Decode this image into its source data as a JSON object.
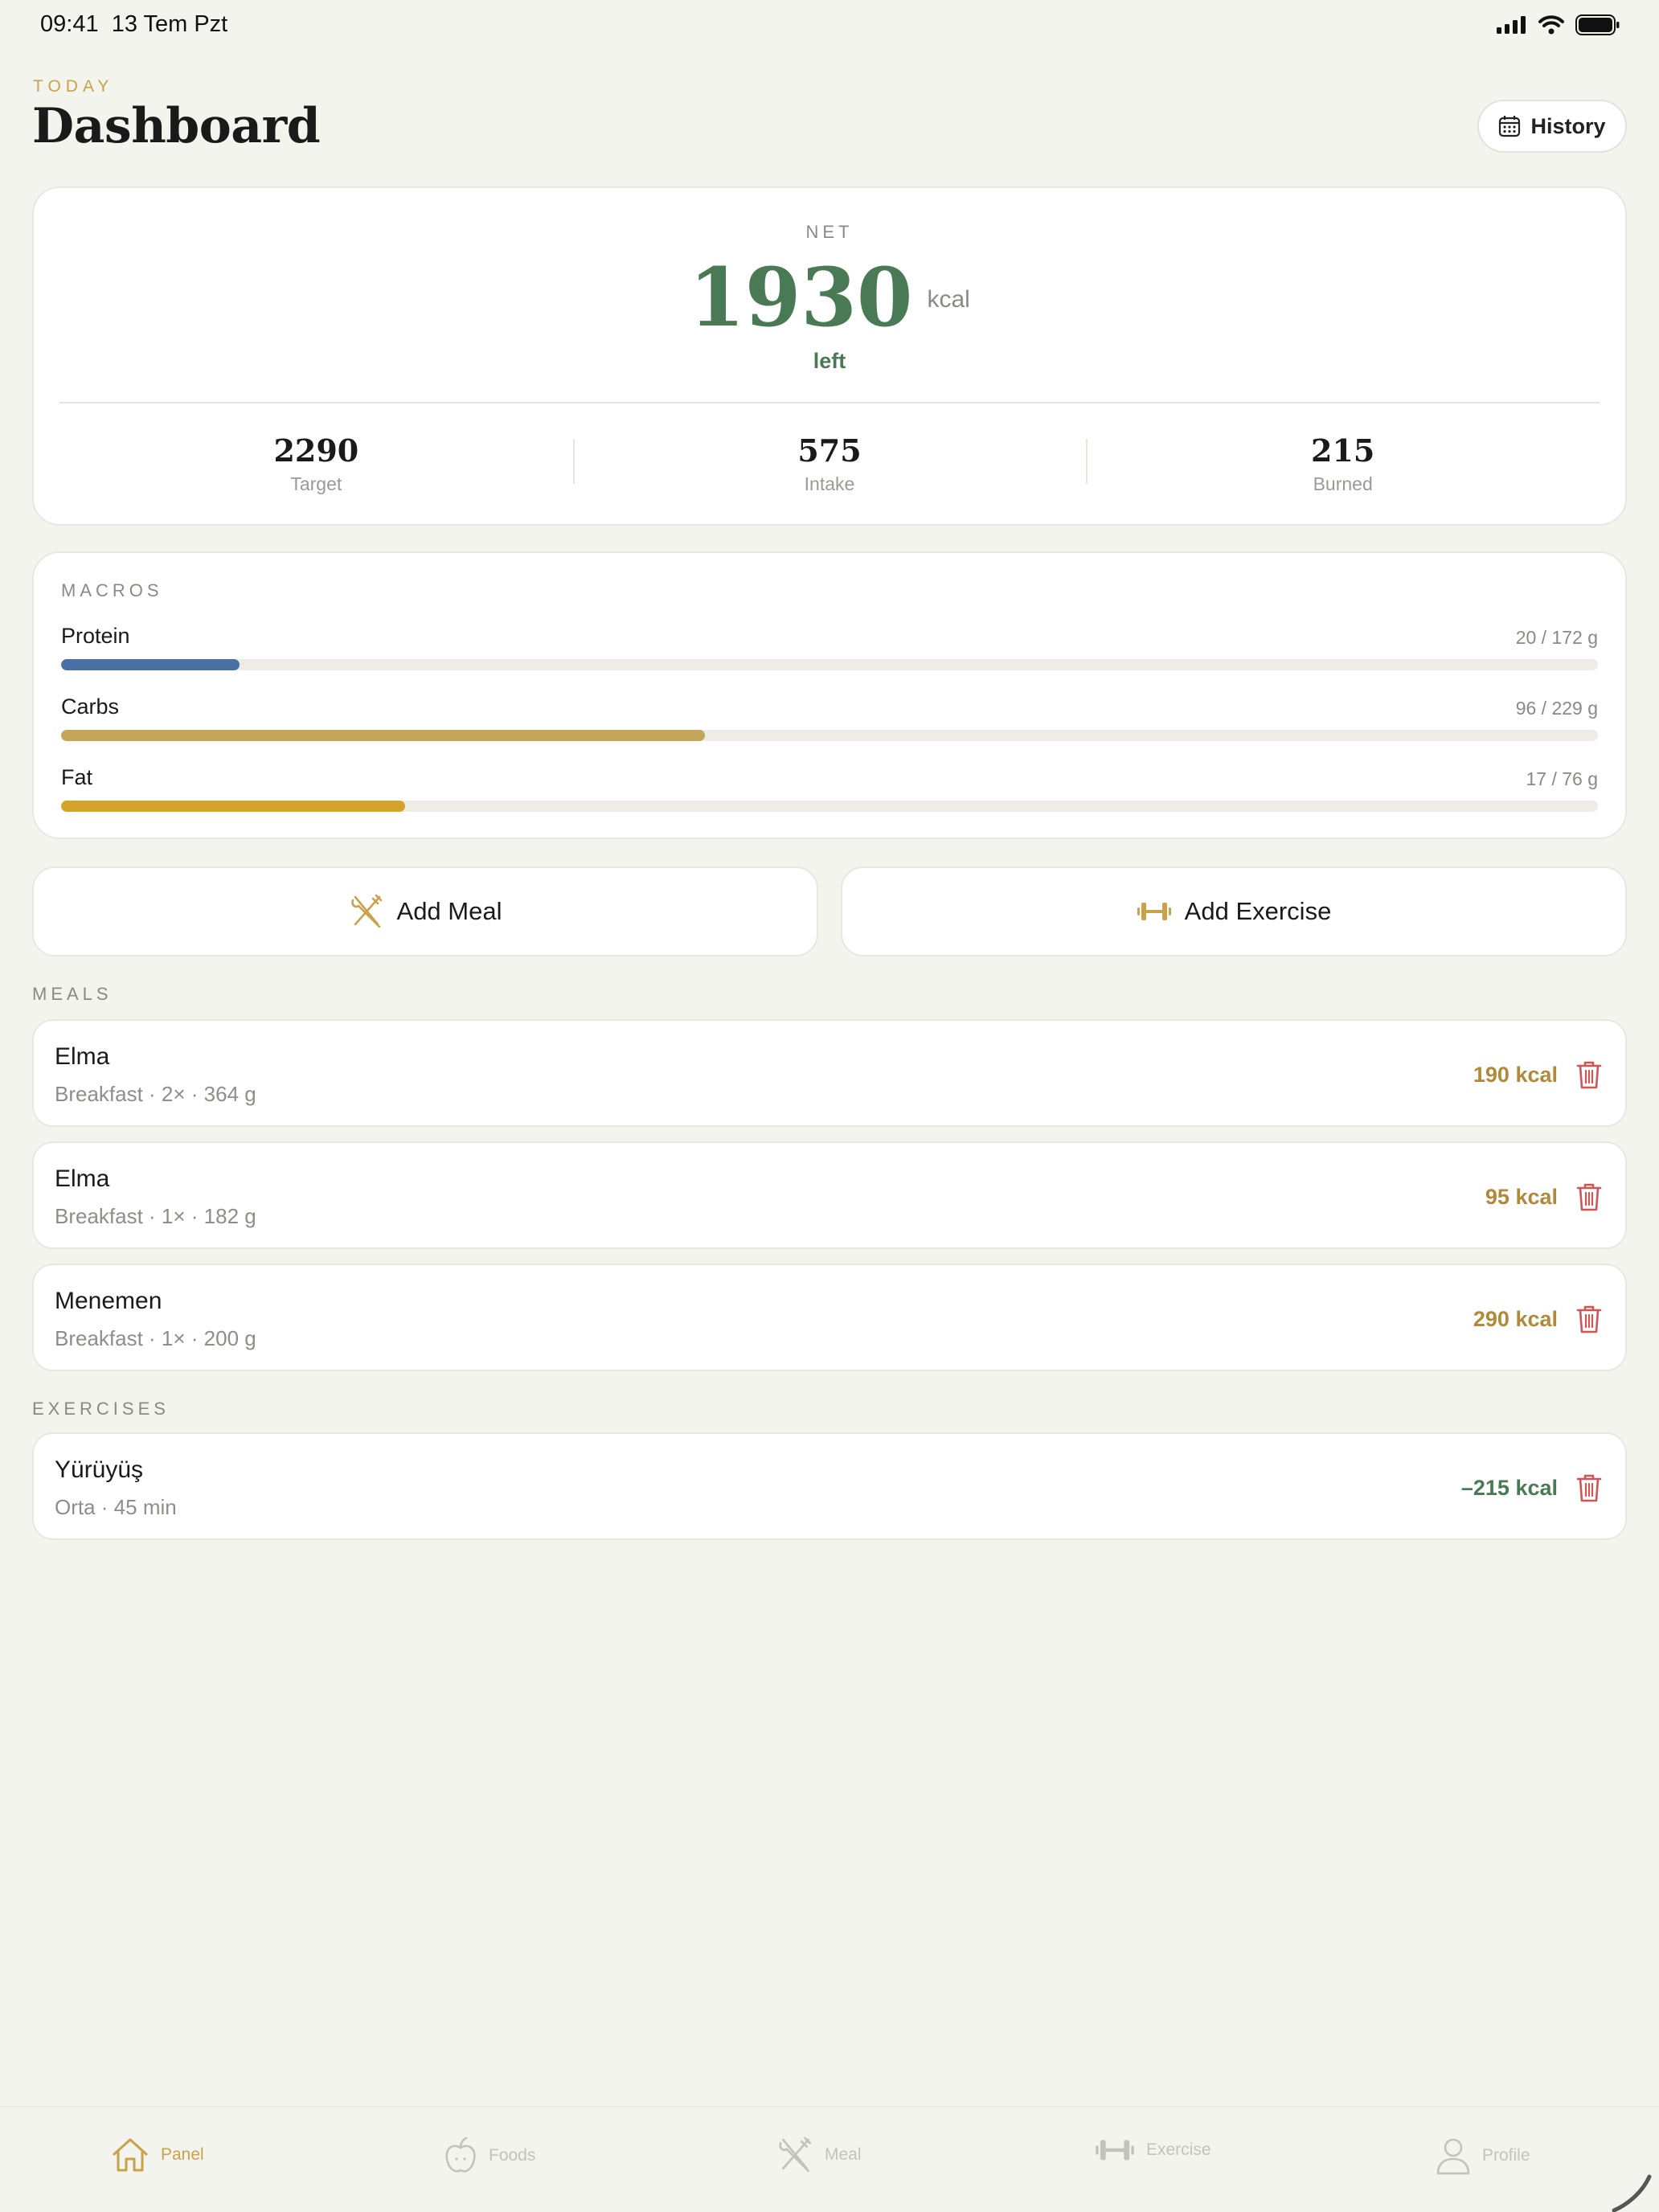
{
  "status_bar": {
    "time": "09:41",
    "date": "13 Tem Pzt"
  },
  "header": {
    "eyebrow": "TODAY",
    "title": "Dashboard",
    "history_label": "History"
  },
  "net": {
    "label": "NET",
    "value": "1930",
    "unit": "kcal",
    "sublabel": "left"
  },
  "stats": [
    {
      "value": "2290",
      "label": "Target"
    },
    {
      "value": "575",
      "label": "Intake"
    },
    {
      "value": "215",
      "label": "Burned"
    }
  ],
  "macros": {
    "label": "MACROS",
    "items": [
      {
        "name": "Protein",
        "value_text": "20 / 172 g",
        "fraction": 0.116,
        "color": "#4a6fa5"
      },
      {
        "name": "Carbs",
        "value_text": "96 / 229 g",
        "fraction": 0.419,
        "color": "#c4a55c"
      },
      {
        "name": "Fat",
        "value_text": "17 / 76 g",
        "fraction": 0.224,
        "color": "#d4a32a"
      }
    ]
  },
  "actions": {
    "add_meal": "Add Meal",
    "add_exercise": "Add Exercise"
  },
  "meals": {
    "label": "MEALS",
    "items": [
      {
        "name": "Elma",
        "detail": "Breakfast · 2× · 364 g",
        "kcal": "190 kcal"
      },
      {
        "name": "Elma",
        "detail": "Breakfast · 1× · 182 g",
        "kcal": "95 kcal"
      },
      {
        "name": "Menemen",
        "detail": "Breakfast · 1× · 200 g",
        "kcal": "290 kcal"
      }
    ]
  },
  "exercises": {
    "label": "EXERCISES",
    "items": [
      {
        "name": "Yürüyüş",
        "detail": "Orta · 45 min",
        "kcal": "–215 kcal"
      }
    ]
  },
  "tabs": [
    {
      "label": "Panel",
      "icon": "home-icon",
      "active": true
    },
    {
      "label": "Foods",
      "icon": "apple-icon",
      "active": false
    },
    {
      "label": "Meal",
      "icon": "utensils-icon",
      "active": false
    },
    {
      "label": "Exercise",
      "icon": "dumbbell-icon",
      "active": false
    },
    {
      "label": "Profile",
      "icon": "person-icon",
      "active": false
    }
  ],
  "colors": {
    "accent": "#c9a24a",
    "green": "#4a7a55",
    "delete": "#d05555",
    "kcal": "#b08a3a"
  }
}
